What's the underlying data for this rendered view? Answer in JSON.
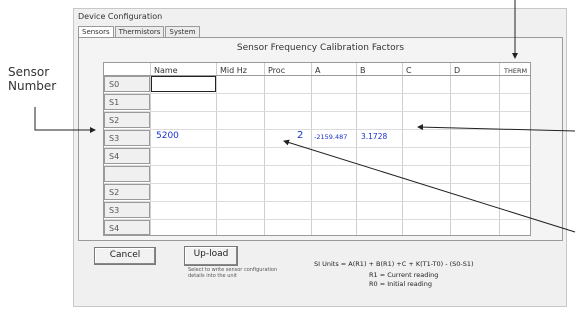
{
  "annotations": {
    "sensor_number_label_line1": "Sensor",
    "sensor_number_label_line2": "Number"
  },
  "window": {
    "title": "Device Configuration",
    "tabs": [
      "Sensors",
      "Thermistors",
      "System"
    ]
  },
  "grid": {
    "title": "Sensor Frequency Calibration Factors",
    "columns": [
      "Name",
      "Mid Hz",
      "Proc",
      "A",
      "B",
      "C",
      "D",
      "THERM"
    ],
    "rows": [
      {
        "label": "S0",
        "name": "",
        "mid_hz": "",
        "proc": "",
        "a": "",
        "b": ""
      },
      {
        "label": "S1",
        "name": "",
        "mid_hz": "",
        "proc": "",
        "a": "",
        "b": ""
      },
      {
        "label": "S2",
        "name": "",
        "mid_hz": "",
        "proc": "",
        "a": "",
        "b": ""
      },
      {
        "label": "S3",
        "name": "5200",
        "mid_hz": "",
        "proc": "2",
        "a": "-2159.487",
        "b": "3.1728"
      },
      {
        "label": "S4",
        "name": "",
        "mid_hz": "",
        "proc": "",
        "a": "",
        "b": ""
      },
      {
        "label": "",
        "name": "",
        "mid_hz": "",
        "proc": "",
        "a": "",
        "b": ""
      },
      {
        "label": "S2",
        "name": "",
        "mid_hz": "",
        "proc": "",
        "a": "",
        "b": ""
      },
      {
        "label": "S3",
        "name": "",
        "mid_hz": "",
        "proc": "",
        "a": "",
        "b": ""
      },
      {
        "label": "S4",
        "name": "",
        "mid_hz": "",
        "proc": "",
        "a": "",
        "b": ""
      }
    ]
  },
  "footer": {
    "cancel_label": "Cancel",
    "upload_label": "Up-load",
    "upload_hint": "Select to write sensor configuration details into the unit",
    "formula": "SI Units = A(R1) + B(R1) +C + K(T1-T0) - (S0-S1)",
    "r1_note": "R1 = Current reading",
    "r0_note": "R0 = Initial reading"
  },
  "colors": {
    "value_text": "#1a33cc",
    "window_bg": "#f0f0f0",
    "arrow": "#222222"
  }
}
